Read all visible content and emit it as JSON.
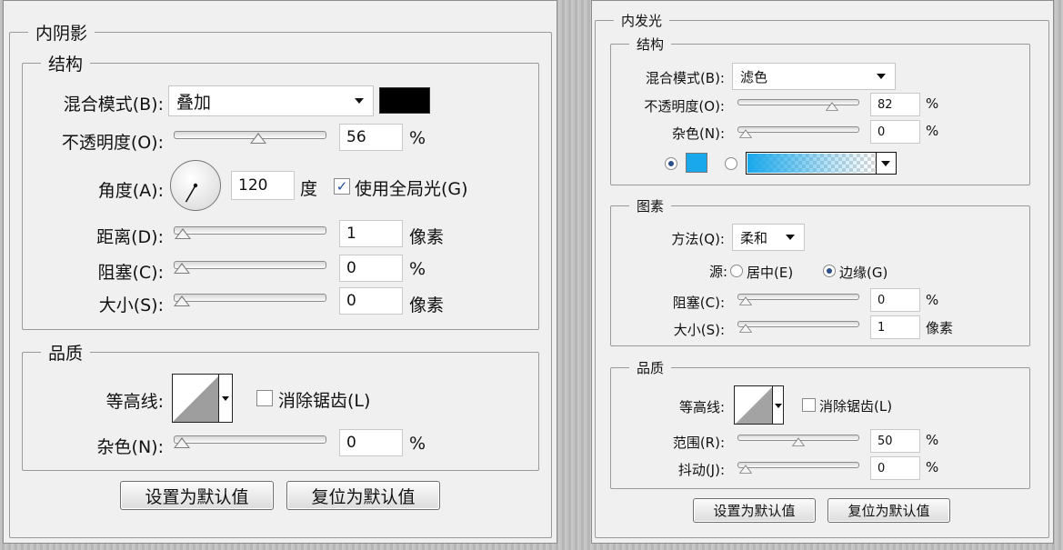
{
  "inner_shadow": {
    "title": "内阴影",
    "structure": {
      "title": "结构",
      "blend_mode": {
        "label": "混合模式(B):",
        "value": "叠加",
        "color": "#000000"
      },
      "opacity": {
        "label": "不透明度(O):",
        "value": "56",
        "unit": "%"
      },
      "angle": {
        "label": "角度(A):",
        "value": "120",
        "unit": "度",
        "degrees": 120
      },
      "global_light": {
        "label": "使用全局光(G)",
        "checked": true
      },
      "distance": {
        "label": "距离(D):",
        "value": "1",
        "unit": "像素"
      },
      "choke": {
        "label": "阻塞(C):",
        "value": "0",
        "unit": "%"
      },
      "size": {
        "label": "大小(S):",
        "value": "0",
        "unit": "像素"
      }
    },
    "quality": {
      "title": "品质",
      "contour": {
        "label": "等高线:"
      },
      "anti_alias": {
        "label": "消除锯齿(L)",
        "checked": false
      },
      "noise": {
        "label": "杂色(N):",
        "value": "0",
        "unit": "%"
      }
    },
    "buttons": {
      "set_default": "设置为默认值",
      "reset_default": "复位为默认值"
    }
  },
  "inner_glow": {
    "title": "内发光",
    "structure": {
      "title": "结构",
      "blend_mode": {
        "label": "混合模式(B):",
        "value": "滤色"
      },
      "opacity": {
        "label": "不透明度(O):",
        "value": "82",
        "unit": "%"
      },
      "noise": {
        "label": "杂色(N):",
        "value": "0",
        "unit": "%"
      },
      "color_mode": "color",
      "glow_color": "#19a8ec"
    },
    "elements": {
      "title": "图素",
      "technique": {
        "label": "方法(Q):",
        "value": "柔和"
      },
      "source": {
        "label": "源:",
        "options": [
          "居中(E)",
          "边缘(G)"
        ],
        "selected": "边缘(G)"
      },
      "choke": {
        "label": "阻塞(C):",
        "value": "0",
        "unit": "%"
      },
      "size": {
        "label": "大小(S):",
        "value": "1",
        "unit": "像素"
      }
    },
    "quality": {
      "title": "品质",
      "contour": {
        "label": "等高线:"
      },
      "anti_alias": {
        "label": "消除锯齿(L)",
        "checked": false
      },
      "range": {
        "label": "范围(R):",
        "value": "50",
        "unit": "%"
      },
      "jitter": {
        "label": "抖动(J):",
        "value": "0",
        "unit": "%"
      }
    },
    "buttons": {
      "set_default": "设置为默认值",
      "reset_default": "复位为默认值"
    }
  }
}
